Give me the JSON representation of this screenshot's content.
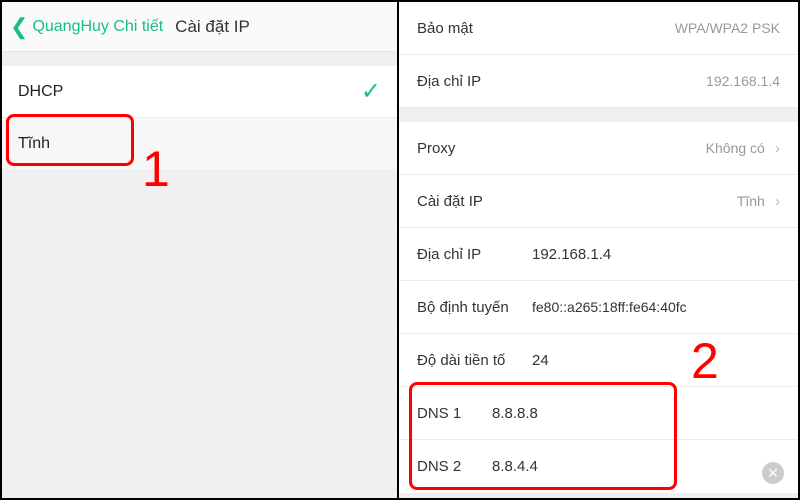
{
  "left": {
    "back_label": "QuangHuy Chi tiết",
    "title": "Cài đặt IP",
    "options": {
      "dhcp": "DHCP",
      "static": "Tĩnh"
    }
  },
  "right": {
    "security": {
      "label": "Bảo mật",
      "value": "WPA/WPA2 PSK"
    },
    "ip_addr_top": {
      "label": "Địa chỉ IP",
      "value": "192.168.1.4"
    },
    "proxy": {
      "label": "Proxy",
      "value": "Không có"
    },
    "ip_setting": {
      "label": "Cài đặt IP",
      "value": "Tĩnh"
    },
    "ip_addr": {
      "label": "Địa chỉ IP",
      "value": "192.168.1.4"
    },
    "router": {
      "label": "Bộ định tuyến",
      "value": "fe80::a265:18ff:fe64:40fc"
    },
    "prefix": {
      "label": "Độ dài tiền tố",
      "value": "24"
    },
    "dns1": {
      "label": "DNS 1",
      "value": "8.8.8.8"
    },
    "dns2": {
      "label": "DNS 2",
      "value": "8.8.4.4"
    }
  },
  "annotations": {
    "one": "1",
    "two": "2"
  }
}
